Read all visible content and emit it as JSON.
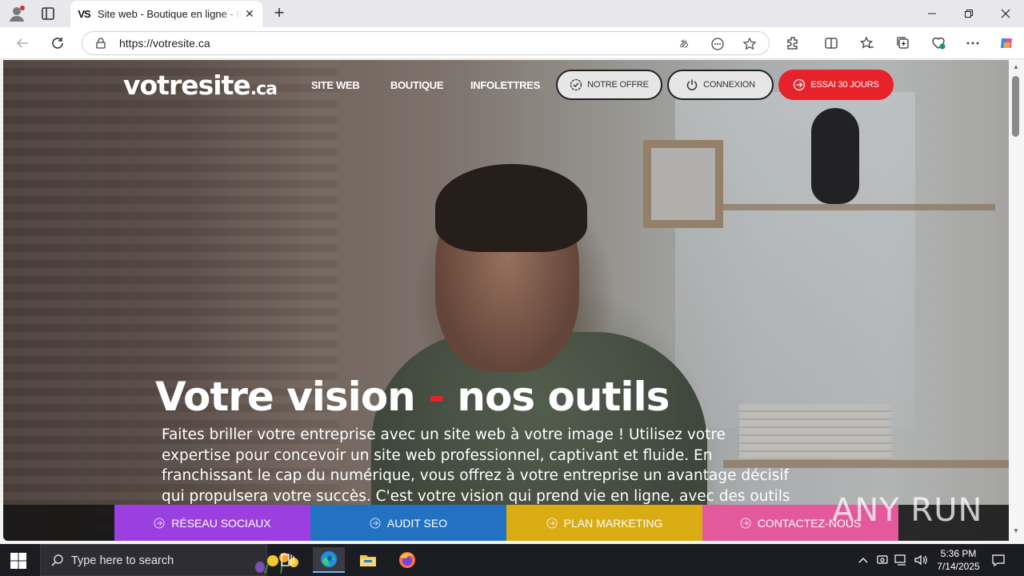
{
  "browser": {
    "tab_title": "Site web - Boutique en ligne - Infolettres",
    "tab_favicon_text": "VS",
    "url": "https://votresite.ca"
  },
  "site": {
    "logo_main": "votresite",
    "logo_tld": ".ca",
    "nav": [
      "SITE WEB",
      "BOUTIQUE",
      "INFOLETTRES"
    ],
    "buttons": {
      "offer": "NOTRE OFFRE",
      "login": "CONNEXION",
      "trial": "ESSAI 30 JOURS"
    },
    "hero": {
      "title_part1": "Votre vision",
      "title_dash": "-",
      "title_part2": "nos outils",
      "text": "Faites briller votre entreprise avec un site web à votre image ! Utilisez votre expertise pour concevoir un site web professionnel, captivant et fluide. En franchissant le cap du numérique, vous offrez à votre entreprise un avantage décisif qui propulsera votre succès. C'est votre vision qui prend vie en ligne, avec des outils conçus pour maximiser"
    },
    "cta": {
      "social": "RÉSEAU SOCIAUX",
      "seo": "AUDIT SEO",
      "marketing": "PLAN MARKETING",
      "contact": "CONTACTEZ-NOUS"
    },
    "colors": {
      "red": "#e6232a",
      "purple": "#9b3fe0",
      "blue": "#2372c2",
      "yellow": "#d9ac14",
      "pink": "#e4589c"
    }
  },
  "watermark": "ANY RUN",
  "taskbar": {
    "search_placeholder": "Type here to search",
    "time": "5:36 PM",
    "date": "7/14/2025"
  }
}
